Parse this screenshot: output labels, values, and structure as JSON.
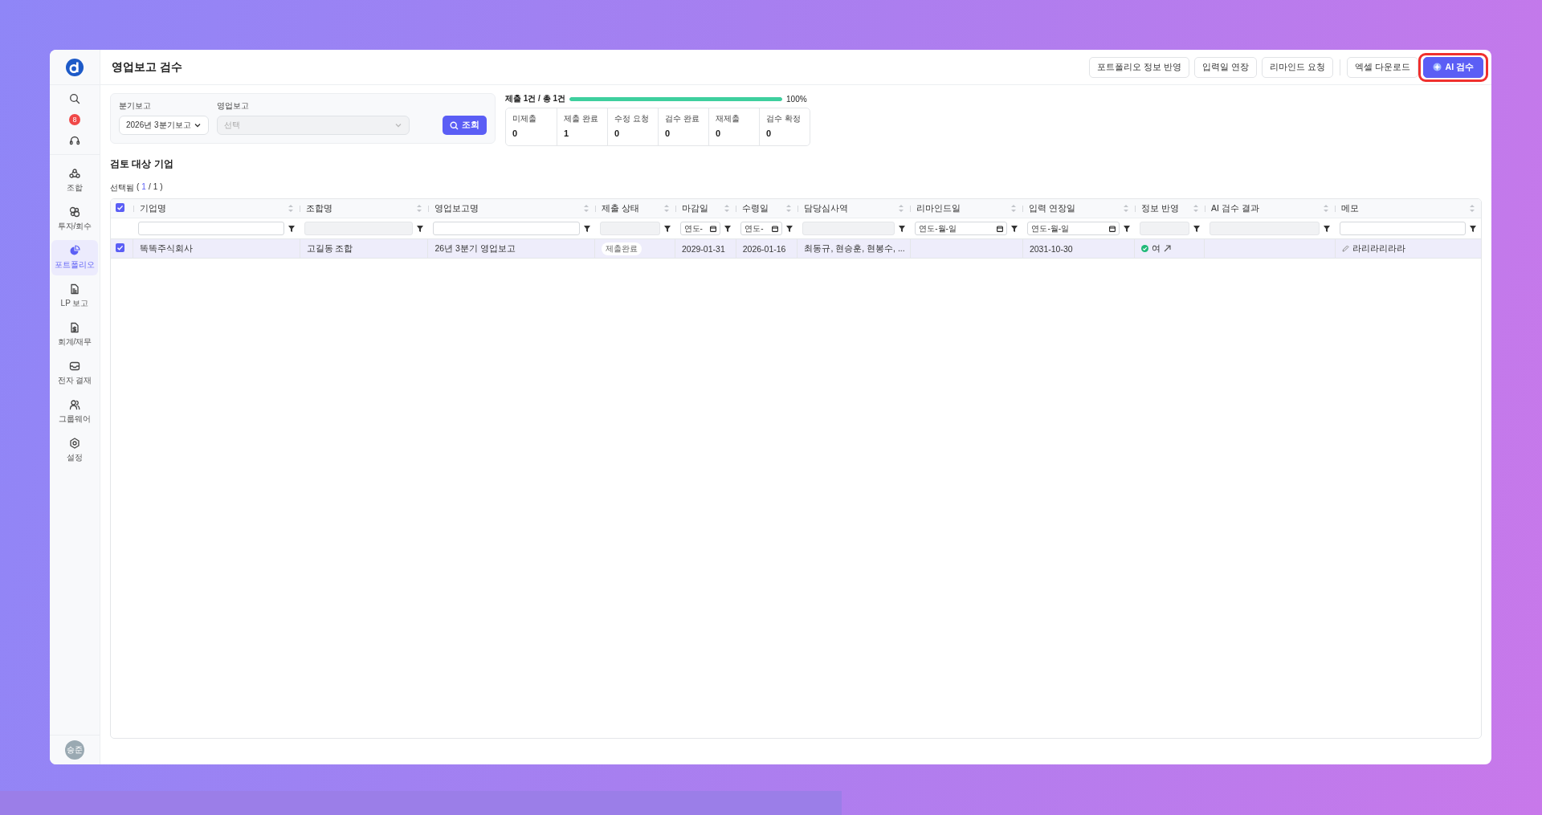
{
  "sidebar": {
    "notification_count": "8",
    "items": [
      {
        "label": "조합",
        "selected": false
      },
      {
        "label": "투자/회수",
        "selected": false
      },
      {
        "label": "포트폴리오",
        "selected": true
      },
      {
        "label": "LP 보고",
        "selected": false
      },
      {
        "label": "회계/재무",
        "selected": false
      },
      {
        "label": "전자 결재",
        "selected": false
      },
      {
        "label": "그룹웨어",
        "selected": false
      },
      {
        "label": "설정",
        "selected": false
      }
    ],
    "avatar": "승준"
  },
  "header": {
    "title": "영업보고 검수",
    "button_groups": [
      [
        {
          "label": "포트폴리오 정보 반영",
          "kind": "outline",
          "highlighted": false
        },
        {
          "label": "입력일 연장",
          "kind": "outline",
          "highlighted": false
        },
        {
          "label": "리마인드 요청",
          "kind": "outline",
          "highlighted": false
        }
      ],
      [
        {
          "label": "엑셀 다운로드",
          "kind": "outline",
          "highlighted": false
        },
        {
          "label": "AI 검수",
          "kind": "primary",
          "highlighted": true
        }
      ]
    ]
  },
  "filters": [
    {
      "label": "분기보고",
      "value": "2026년 3분기보고",
      "disabled": false
    },
    {
      "label": "영업보고",
      "placeholder": "선택",
      "disabled": true
    }
  ],
  "search_button": "조회",
  "progress": {
    "label": "제출 1건 / 총 1건",
    "level": 1,
    "reading": "100%"
  },
  "stats": [
    {
      "label": "미제출",
      "value": "0"
    },
    {
      "label": "제출 완료",
      "value": "1"
    },
    {
      "label": "수정 요청",
      "value": "0"
    },
    {
      "label": "검수 완료",
      "value": "0"
    },
    {
      "label": "재제출",
      "value": "0"
    },
    {
      "label": "검수 확정",
      "value": "0"
    }
  ],
  "section_title": "검토 대상 기업",
  "selection": {
    "label": "선택됨",
    "open": "(",
    "count": "1",
    "separator": "/",
    "total": "1",
    "close": ")"
  },
  "table": {
    "all_checked": true,
    "columns": [
      {
        "label": "기업명",
        "kind": "text",
        "disabled": false
      },
      {
        "label": "조합명",
        "kind": "text",
        "disabled": true
      },
      {
        "label": "영업보고명",
        "kind": "text",
        "disabled": false
      },
      {
        "label": "제출 상태",
        "kind": "text",
        "disabled": true
      },
      {
        "label": "마감일",
        "kind": "date",
        "placeholder": "연도-"
      },
      {
        "label": "수령일",
        "kind": "date",
        "placeholder": "연도-"
      },
      {
        "label": "담당심사역",
        "kind": "text",
        "disabled": true
      },
      {
        "label": "리마인드일",
        "kind": "date",
        "placeholder": "연도-월-일"
      },
      {
        "label": "입력 연장일",
        "kind": "date",
        "placeholder": "연도-월-일"
      },
      {
        "label": "정보 반영",
        "kind": "text",
        "disabled": true
      },
      {
        "label": "AI 검수 결과",
        "kind": "text",
        "disabled": true
      },
      {
        "label": "메모",
        "kind": "text",
        "disabled": false
      }
    ],
    "rows": [
      {
        "checked": true,
        "selected": true,
        "cells": [
          {
            "kind": "text",
            "text": "똑똑주식회사"
          },
          {
            "kind": "text",
            "text": "고길동 조합"
          },
          {
            "kind": "text",
            "text": "26년 3분기 영업보고"
          },
          {
            "kind": "badge",
            "text": "제출완료"
          },
          {
            "kind": "text",
            "text": "2029-01-31"
          },
          {
            "kind": "text",
            "text": "2026-01-16"
          },
          {
            "kind": "text",
            "text": "최동규, 현승훈, 현봉수, ..."
          },
          {
            "kind": "empty"
          },
          {
            "kind": "text",
            "text": "2031-10-30"
          },
          {
            "kind": "status",
            "text": "여"
          },
          {
            "kind": "empty"
          },
          {
            "kind": "memo",
            "text": "라리라리라라"
          }
        ]
      }
    ]
  }
}
